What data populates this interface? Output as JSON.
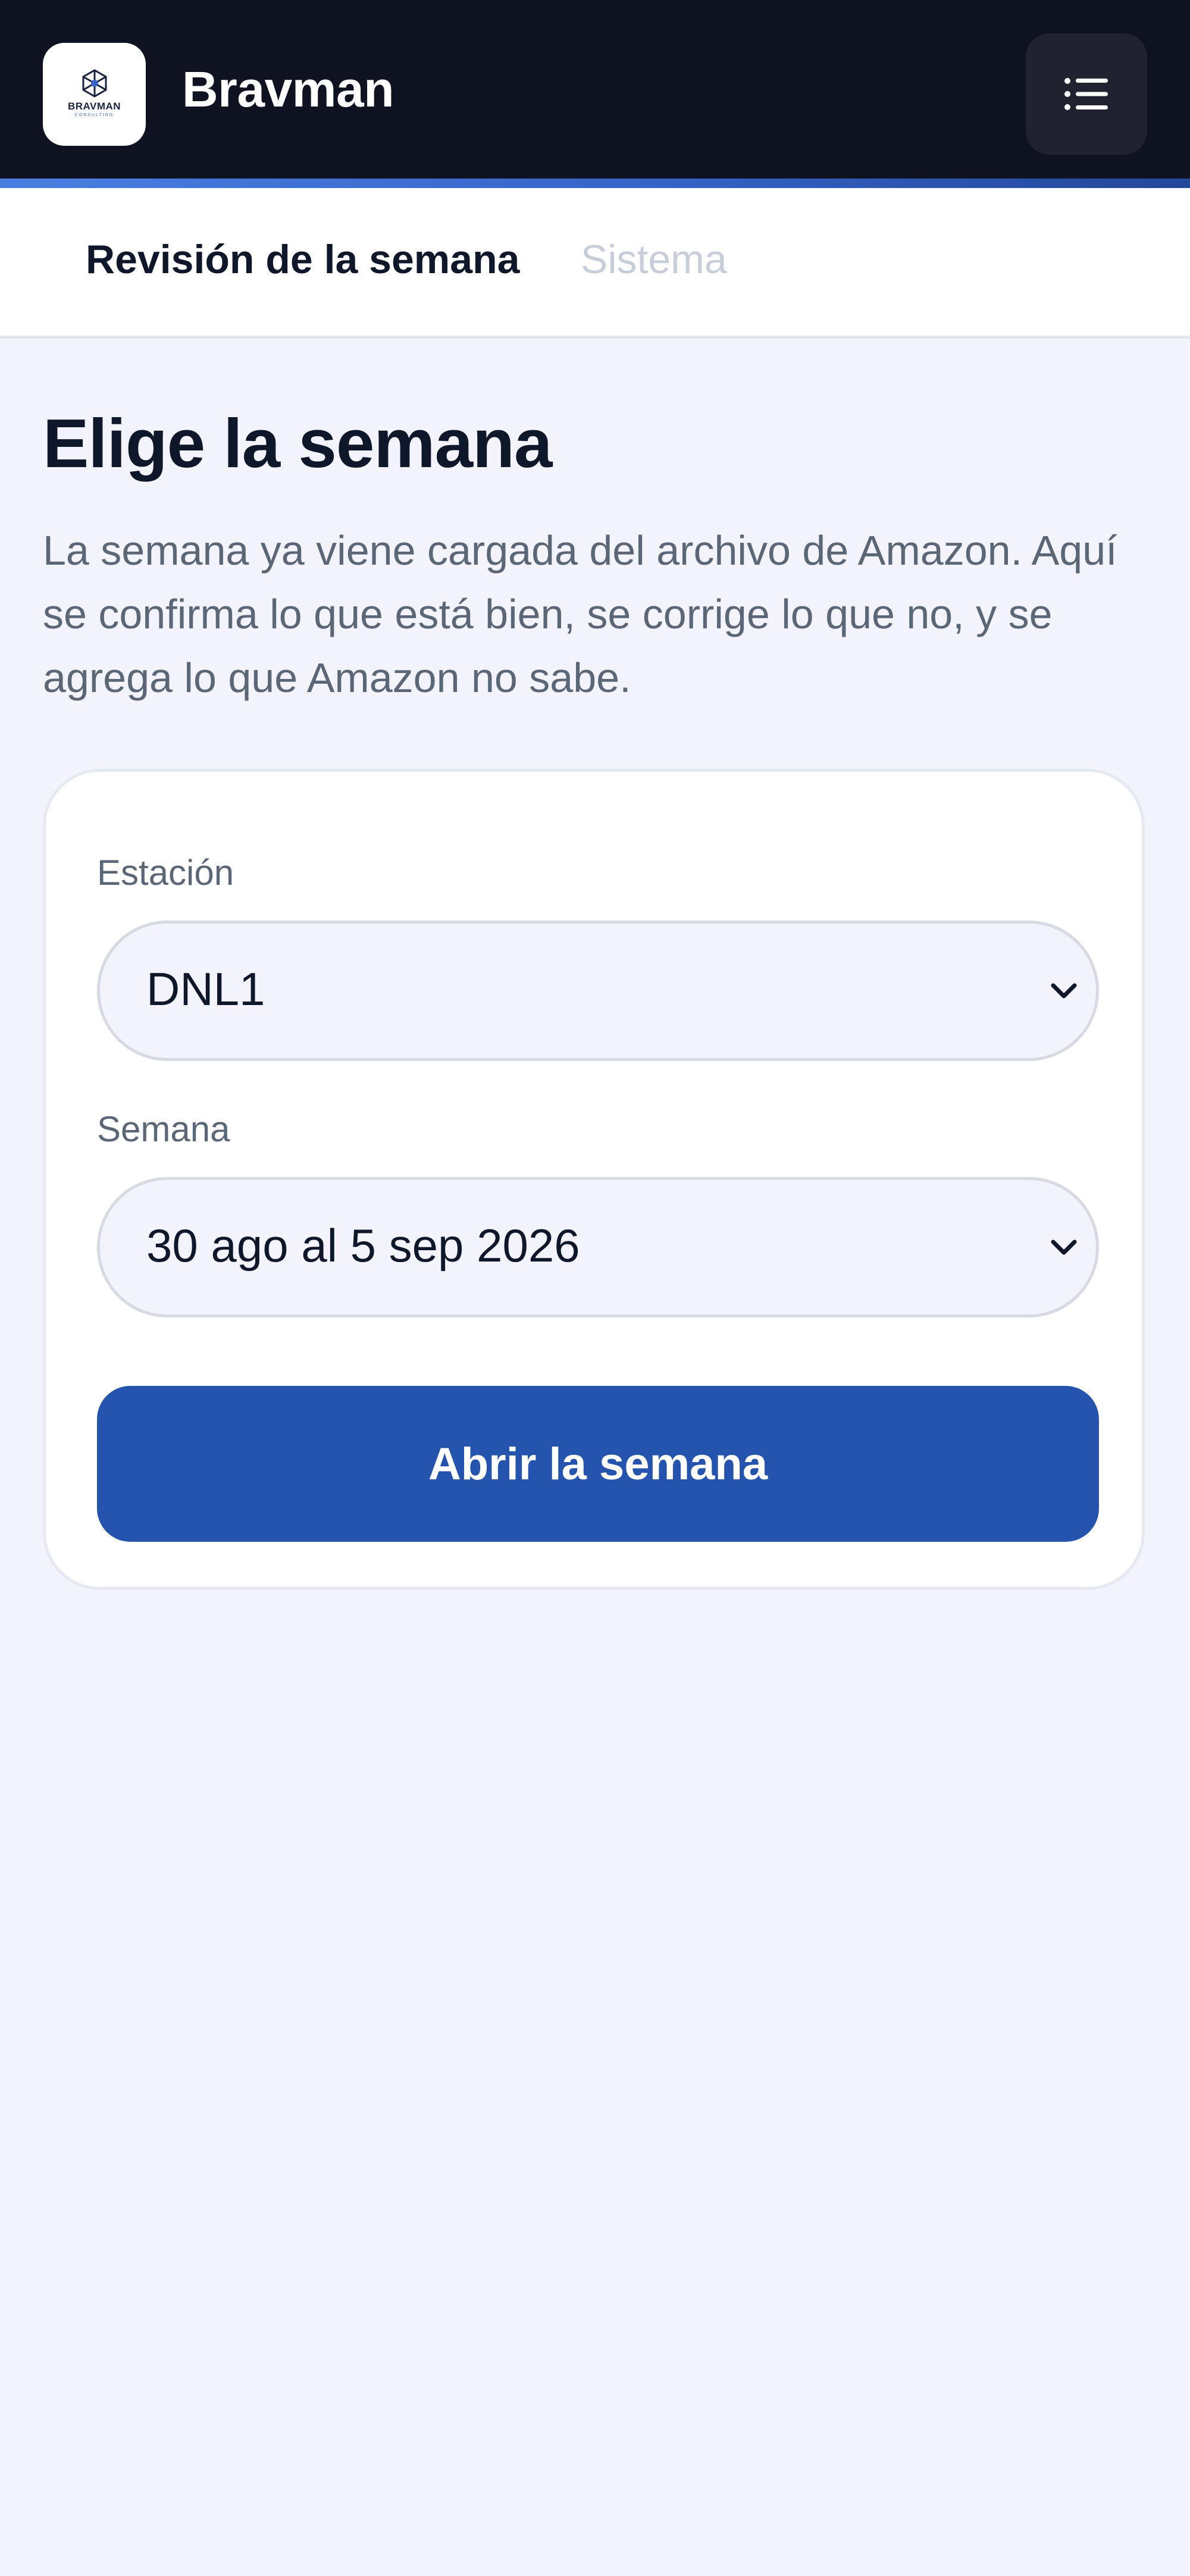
{
  "app": {
    "brand_name": "Bravman",
    "logo_text": "BRAVMAN",
    "logo_subtext": "CONSULTING",
    "menu_icon": "menu-list-icon"
  },
  "tabs": [
    {
      "label": "Revisión de la semana",
      "active": true
    },
    {
      "label": "Sistema",
      "active": false
    }
  ],
  "main": {
    "title": "Elige la semana",
    "intro": "La semana ya viene cargada del archivo de Amazon. Aquí se confirma lo que está bien, se corrige lo que no, y se agrega lo que Amazon no sabe."
  },
  "form": {
    "station": {
      "label": "Estación",
      "value": "DNL1"
    },
    "week": {
      "label": "Semana",
      "value": "30 ago al 5 sep 2026"
    },
    "submit_label": "Abrir la semana"
  },
  "colors": {
    "header_bg": "#0f1221",
    "accent": "#2454ad",
    "page_bg": "#f2f3fb",
    "text_primary": "#0f172a",
    "text_muted": "#5b6676",
    "tab_inactive": "#c7cdd9"
  }
}
